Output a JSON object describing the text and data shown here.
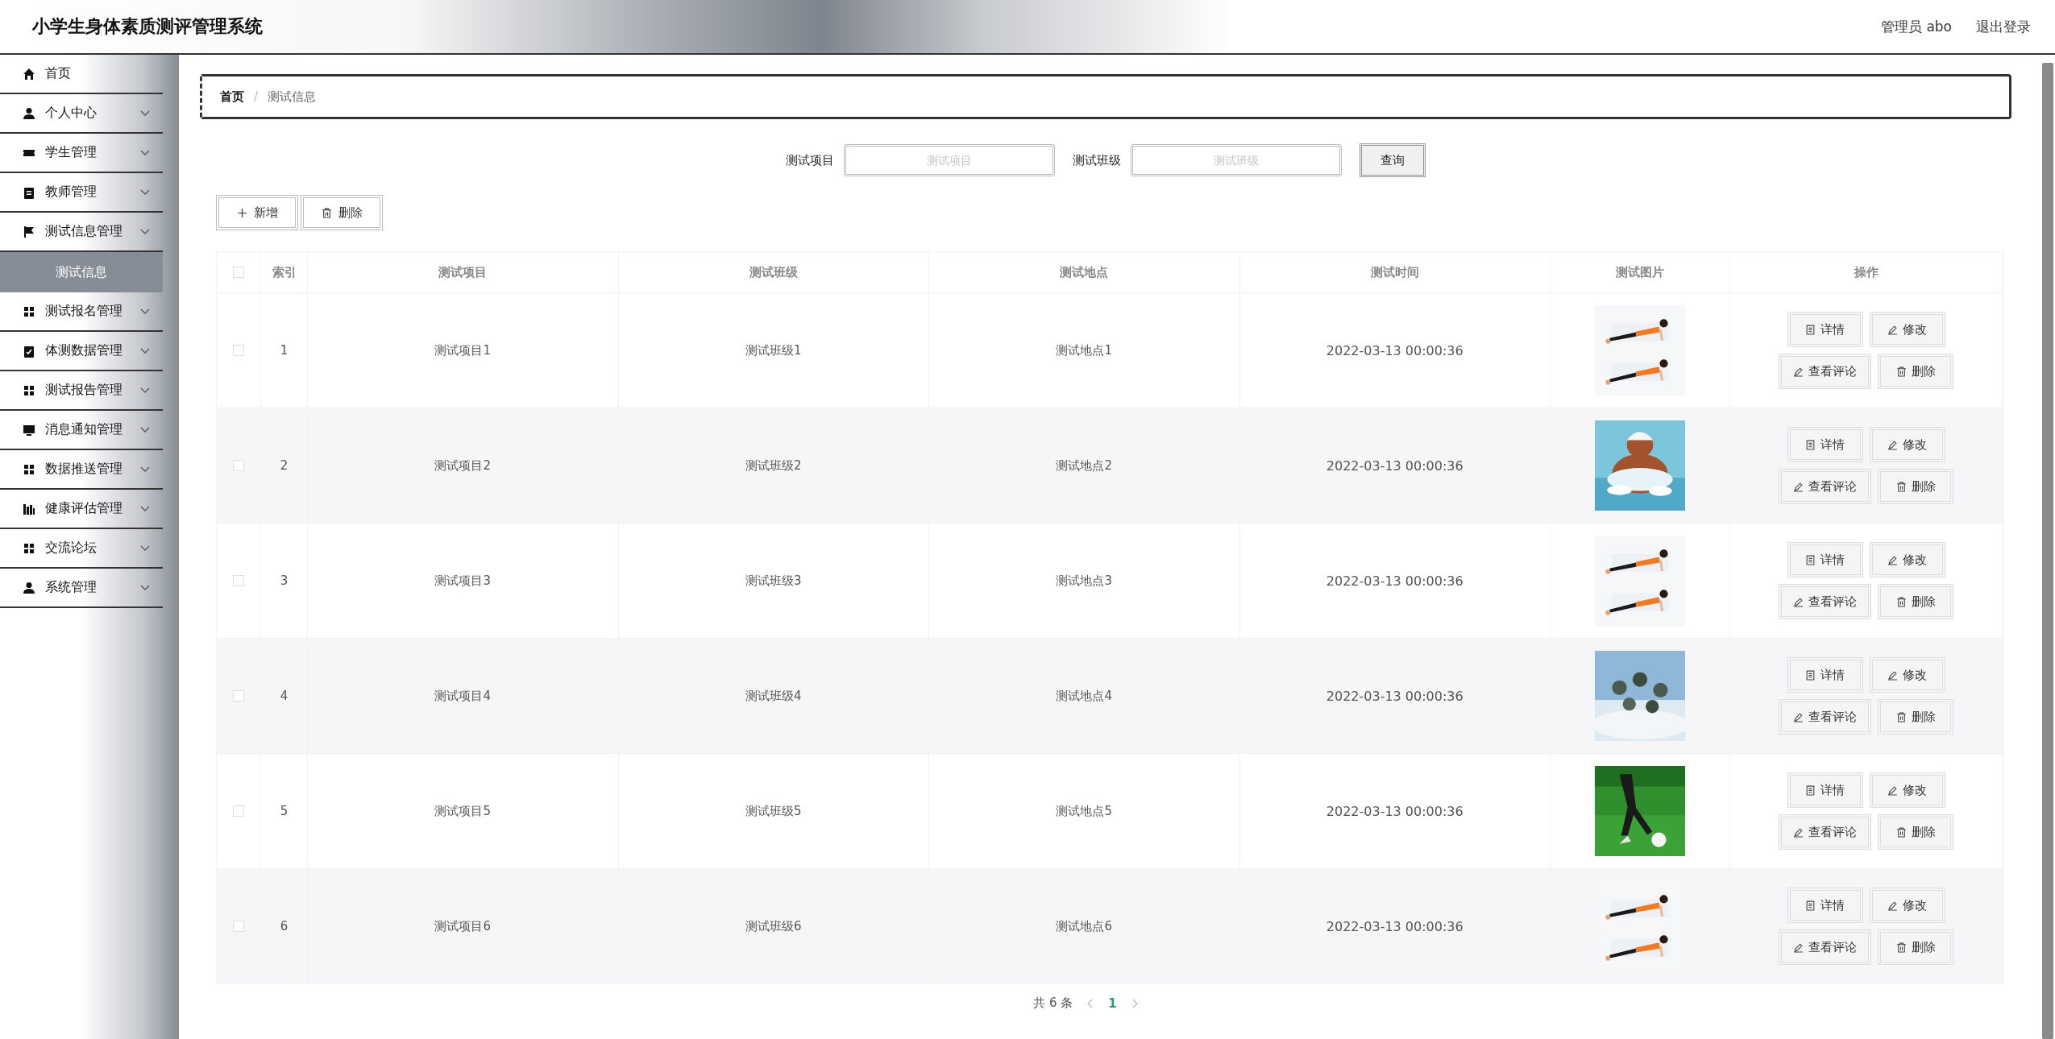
{
  "header": {
    "title": "小学生身体素质测评管理系统",
    "user": "管理员 abo",
    "logout": "退出登录"
  },
  "sidebar": {
    "items": [
      {
        "label": "首页",
        "kind": "link"
      },
      {
        "label": "个人中心",
        "kind": "menu"
      },
      {
        "label": "学生管理",
        "kind": "menu"
      },
      {
        "label": "教师管理",
        "kind": "menu"
      },
      {
        "label": "测试信息管理",
        "kind": "menu",
        "children": [
          {
            "label": "测试信息",
            "selected": true
          }
        ]
      },
      {
        "label": "测试报名管理",
        "kind": "menu"
      },
      {
        "label": "体测数据管理",
        "kind": "menu"
      },
      {
        "label": "测试报告管理",
        "kind": "menu"
      },
      {
        "label": "消息通知管理",
        "kind": "menu"
      },
      {
        "label": "数据推送管理",
        "kind": "menu"
      },
      {
        "label": "健康评估管理",
        "kind": "menu"
      },
      {
        "label": "交流论坛",
        "kind": "menu"
      },
      {
        "label": "系统管理",
        "kind": "menu"
      }
    ]
  },
  "breadcrumb": {
    "items": [
      "首页",
      "测试信息"
    ],
    "separator": "/"
  },
  "search": {
    "fields": [
      {
        "label": "测试项目",
        "placeholder": "测试项目"
      },
      {
        "label": "测试班级",
        "placeholder": "测试班级"
      }
    ],
    "button": "查询"
  },
  "toolbar": [
    "新增",
    "删除"
  ],
  "table": {
    "header_checked": false,
    "columns": [
      "索引",
      "测试项目",
      "测试班级",
      "测试地点",
      "测试时间",
      "测试图片",
      "操作"
    ],
    "rows": [
      {
        "checked": false,
        "index": "1",
        "item": "测试项目1",
        "class": "测试班级1",
        "location": "测试地点1",
        "time": "2022-03-13 00:00:36",
        "actions": [
          "详情",
          "修改",
          "查看评论",
          "删除"
        ]
      },
      {
        "checked": false,
        "index": "2",
        "item": "测试项目2",
        "class": "测试班级2",
        "location": "测试地点2",
        "time": "2022-03-13 00:00:36",
        "actions": [
          "详情",
          "修改",
          "查看评论",
          "删除"
        ]
      },
      {
        "checked": false,
        "index": "3",
        "item": "测试项目3",
        "class": "测试班级3",
        "location": "测试地点3",
        "time": "2022-03-13 00:00:36",
        "actions": [
          "详情",
          "修改",
          "查看评论",
          "删除"
        ]
      },
      {
        "checked": false,
        "index": "4",
        "item": "测试项目4",
        "class": "测试班级4",
        "location": "测试地点4",
        "time": "2022-03-13 00:00:36",
        "actions": [
          "详情",
          "修改",
          "查看评论",
          "删除"
        ]
      },
      {
        "checked": false,
        "index": "5",
        "item": "测试项目5",
        "class": "测试班级5",
        "location": "测试地点5",
        "time": "2022-03-13 00:00:36",
        "actions": [
          "详情",
          "修改",
          "查看评论",
          "删除"
        ]
      },
      {
        "checked": false,
        "index": "6",
        "item": "测试项目6",
        "class": "测试班级6",
        "location": "测试地点6",
        "time": "2022-03-13 00:00:36",
        "actions": [
          "详情",
          "修改",
          "查看评论",
          "删除"
        ]
      }
    ]
  },
  "pagination": {
    "total": "共 6 条",
    "pages": [
      {
        "label": "1",
        "selected": true
      }
    ]
  }
}
